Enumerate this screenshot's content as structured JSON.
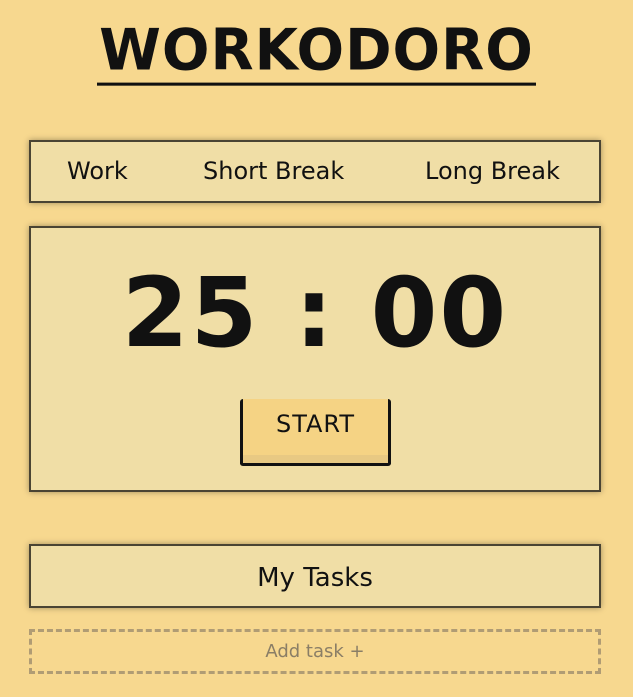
{
  "app": {
    "title": "WORKODORO"
  },
  "modes": {
    "items": [
      {
        "label": "Work"
      },
      {
        "label": "Short Break"
      },
      {
        "label": "Long Break"
      }
    ]
  },
  "timer": {
    "display": "25 : 00",
    "start_label": "START"
  },
  "tasks": {
    "title": "My Tasks",
    "add_label": "Add task +"
  },
  "colors": {
    "background": "#f7d88f",
    "panel": "#f0dea6",
    "button": "#f5d384",
    "text": "#111111",
    "muted": "#8a7e66"
  }
}
